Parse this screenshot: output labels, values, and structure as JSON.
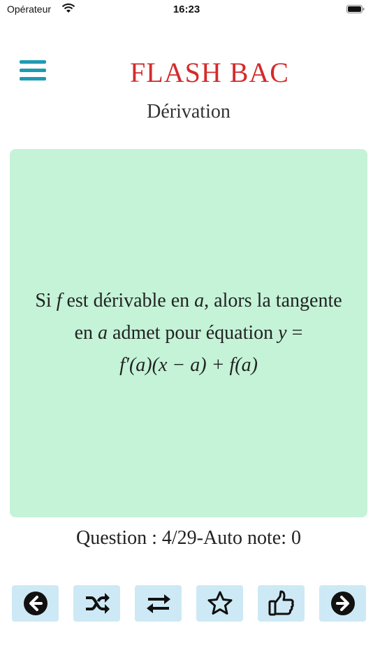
{
  "status_bar": {
    "carrier": "Opérateur",
    "time": "16:23"
  },
  "header": {
    "menu_icon": "hamburger-menu-icon",
    "app_title": "FLASH BAC",
    "chapter": "Dérivation"
  },
  "card": {
    "line1_pre": "Si ",
    "line1_var_f": "f",
    "line1_mid": " est dérivable en ",
    "line1_var_a": "a",
    "line1_post": ", alors la tangente",
    "line2_pre": "en ",
    "line2_var_a": "a",
    "line2_mid": " admet pour équation ",
    "line2_var_y": "y",
    "line2_eq": " =",
    "line3_formula": "f′(a)(x − a) + f(a)"
  },
  "progress_text": "Question : 4/29-Auto note: 0",
  "toolbar": {
    "buttons": [
      {
        "icon": "arrow-left-circle-icon"
      },
      {
        "icon": "shuffle-icon"
      },
      {
        "icon": "repeat-swap-icon"
      },
      {
        "icon": "star-outline-icon"
      },
      {
        "icon": "thumbs-up-icon"
      },
      {
        "icon": "arrow-right-circle-icon"
      }
    ]
  },
  "colors": {
    "title_red": "#d42b2b",
    "menu_teal": "#1e9bb5",
    "card_green": "#c4f3d7",
    "toolbar_button_bg": "#cde9f5"
  }
}
